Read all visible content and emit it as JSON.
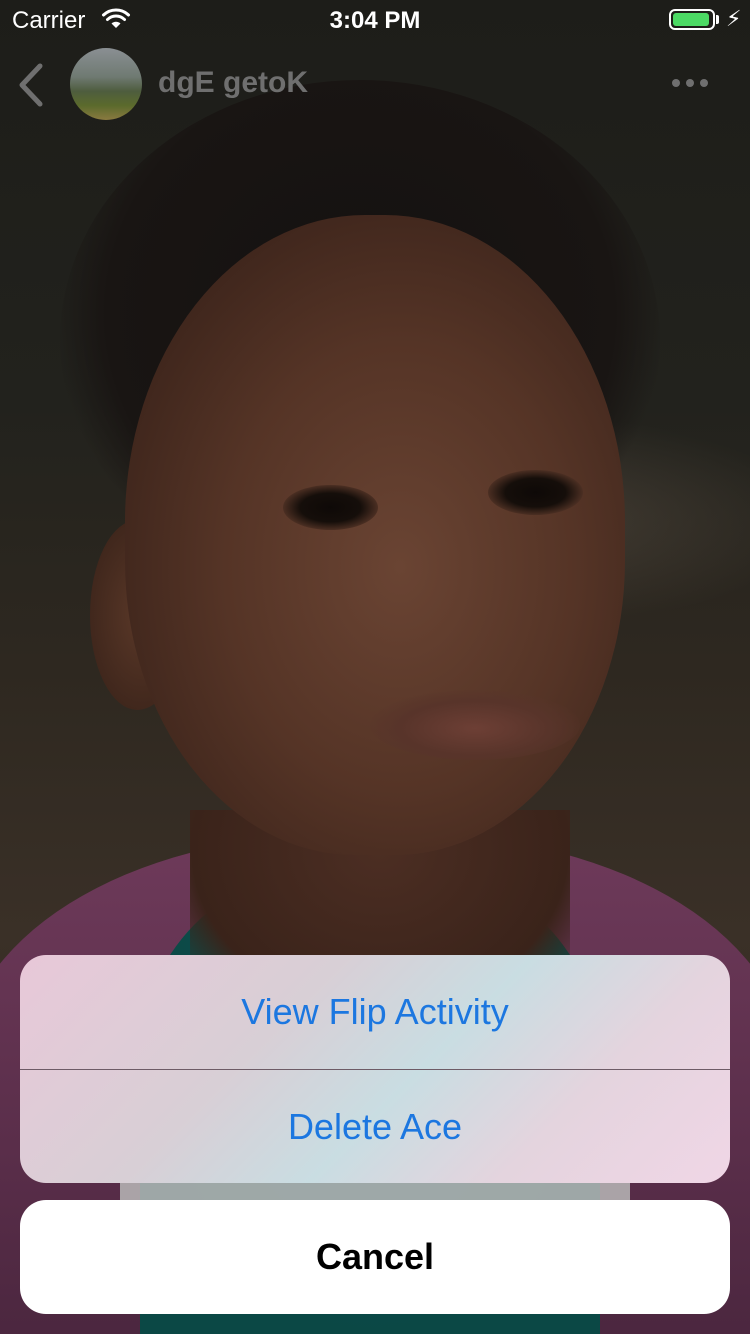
{
  "status_bar": {
    "carrier": "Carrier",
    "time": "3:04 PM",
    "battery_level": 0.9,
    "battery_color": "#4cd964"
  },
  "header": {
    "back_icon": "chevron-left-icon",
    "username": "dgE getoK",
    "more_icon": "ellipsis-icon"
  },
  "action_sheet": {
    "actions": [
      {
        "label": "View Flip Activity"
      },
      {
        "label": "Delete Ace"
      }
    ],
    "cancel_label": "Cancel",
    "action_color": "#1c77e0"
  }
}
